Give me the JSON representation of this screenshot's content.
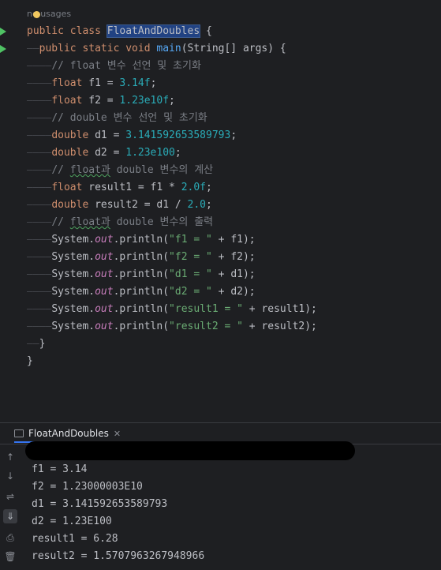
{
  "editor": {
    "usages": "no usages",
    "lines": [
      [
        {
          "t": "public class ",
          "c": "kw"
        },
        {
          "t": "FloatAndDoubles",
          "c": "cls",
          "caret": true
        },
        {
          "t": " {",
          "c": ""
        }
      ],
      [
        {
          "t": "——",
          "c": "guide"
        },
        {
          "t": "public static void ",
          "c": "kw"
        },
        {
          "t": "main",
          "c": "fn"
        },
        {
          "t": "(String[] args) {",
          "c": ""
        }
      ],
      [
        {
          "t": "————",
          "c": "guide"
        },
        {
          "t": "// float 변수 선언 및 초기화",
          "c": "cmt"
        }
      ],
      [
        {
          "t": "————",
          "c": "guide"
        },
        {
          "t": "float ",
          "c": "kw"
        },
        {
          "t": "f1 = ",
          "c": ""
        },
        {
          "t": "3.14f",
          "c": "num"
        },
        {
          "t": ";",
          "c": ""
        }
      ],
      [
        {
          "t": "————",
          "c": "guide"
        },
        {
          "t": "float ",
          "c": "kw"
        },
        {
          "t": "f2 = ",
          "c": ""
        },
        {
          "t": "1.23e10f",
          "c": "num"
        },
        {
          "t": ";",
          "c": ""
        }
      ],
      [
        {
          "t": "————",
          "c": "guide"
        },
        {
          "t": "// double 변수 선언 및 초기화",
          "c": "cmt"
        }
      ],
      [
        {
          "t": "————",
          "c": "guide"
        },
        {
          "t": "double ",
          "c": "kw"
        },
        {
          "t": "d1 = ",
          "c": ""
        },
        {
          "t": "3.141592653589793",
          "c": "num"
        },
        {
          "t": ";",
          "c": ""
        }
      ],
      [
        {
          "t": "————",
          "c": "guide"
        },
        {
          "t": "double ",
          "c": "kw"
        },
        {
          "t": "d2 = ",
          "c": ""
        },
        {
          "t": "1.23e100",
          "c": "num"
        },
        {
          "t": ";",
          "c": ""
        }
      ],
      [
        {
          "t": "————",
          "c": "guide"
        },
        {
          "t": "// ",
          "c": "cmt"
        },
        {
          "t": "float과",
          "c": "cmt squig"
        },
        {
          "t": " double 변수의 계산",
          "c": "cmt"
        }
      ],
      [
        {
          "t": "————",
          "c": "guide"
        },
        {
          "t": "float ",
          "c": "kw"
        },
        {
          "t": "result1 = f1 * ",
          "c": ""
        },
        {
          "t": "2.0f",
          "c": "num"
        },
        {
          "t": ";",
          "c": ""
        }
      ],
      [
        {
          "t": "————",
          "c": "guide"
        },
        {
          "t": "double ",
          "c": "kw"
        },
        {
          "t": "result2 = d1 / ",
          "c": ""
        },
        {
          "t": "2.0",
          "c": "num"
        },
        {
          "t": ";",
          "c": ""
        }
      ],
      [
        {
          "t": "————",
          "c": "guide"
        },
        {
          "t": "// ",
          "c": "cmt"
        },
        {
          "t": "float과",
          "c": "cmt squig"
        },
        {
          "t": " double 변수의 출력",
          "c": "cmt"
        }
      ],
      [
        {
          "t": "————",
          "c": "guide"
        },
        {
          "t": "System.",
          "c": ""
        },
        {
          "t": "out",
          "c": "out"
        },
        {
          "t": ".println(",
          "c": ""
        },
        {
          "t": "\"f1 = \"",
          "c": "str"
        },
        {
          "t": " + f1);",
          "c": ""
        }
      ],
      [
        {
          "t": "————",
          "c": "guide"
        },
        {
          "t": "System.",
          "c": ""
        },
        {
          "t": "out",
          "c": "out"
        },
        {
          "t": ".println(",
          "c": ""
        },
        {
          "t": "\"f2 = \"",
          "c": "str"
        },
        {
          "t": " + f2);",
          "c": ""
        }
      ],
      [
        {
          "t": "————",
          "c": "guide"
        },
        {
          "t": "System.",
          "c": ""
        },
        {
          "t": "out",
          "c": "out"
        },
        {
          "t": ".println(",
          "c": ""
        },
        {
          "t": "\"d1 = \"",
          "c": "str"
        },
        {
          "t": " + d1);",
          "c": ""
        }
      ],
      [
        {
          "t": "————",
          "c": "guide"
        },
        {
          "t": "System.",
          "c": ""
        },
        {
          "t": "out",
          "c": "out"
        },
        {
          "t": ".println(",
          "c": ""
        },
        {
          "t": "\"d2 = \"",
          "c": "str"
        },
        {
          "t": " + d2);",
          "c": ""
        }
      ],
      [
        {
          "t": "————",
          "c": "guide"
        },
        {
          "t": "System.",
          "c": ""
        },
        {
          "t": "out",
          "c": "out"
        },
        {
          "t": ".println(",
          "c": ""
        },
        {
          "t": "\"result1 = \"",
          "c": "str"
        },
        {
          "t": " + result1);",
          "c": ""
        }
      ],
      [
        {
          "t": "————",
          "c": "guide"
        },
        {
          "t": "System.",
          "c": ""
        },
        {
          "t": "out",
          "c": "out"
        },
        {
          "t": ".println(",
          "c": ""
        },
        {
          "t": "\"result2 = \"",
          "c": "str"
        },
        {
          "t": " + result2);",
          "c": ""
        }
      ],
      [
        {
          "t": "——",
          "c": "guide"
        },
        {
          "t": "}",
          "c": ""
        }
      ],
      [
        {
          "t": "}",
          "c": ""
        }
      ]
    ]
  },
  "run_panel": {
    "tab_label": "FloatAndDoubles",
    "close_glyph": "✕",
    "tools": [
      "↑",
      "↓",
      "⇌",
      "⇓",
      "⎙",
      "🗑"
    ],
    "output": [
      "f1 = 3.14",
      "f2 = 1.23000003E10",
      "d1 = 3.141592653589793",
      "d2 = 1.23E100",
      "result1 = 6.28",
      "result2 = 1.5707963267948966"
    ]
  },
  "colors": {
    "background": "#1e1f22",
    "keyword": "#cf8e6d",
    "number": "#2aacb8",
    "string": "#6aab73",
    "comment": "#7a7e85",
    "method": "#56a8f5",
    "static_field": "#c77dbb",
    "run_icon": "#4fc264",
    "tab_accent": "#3574f0"
  }
}
